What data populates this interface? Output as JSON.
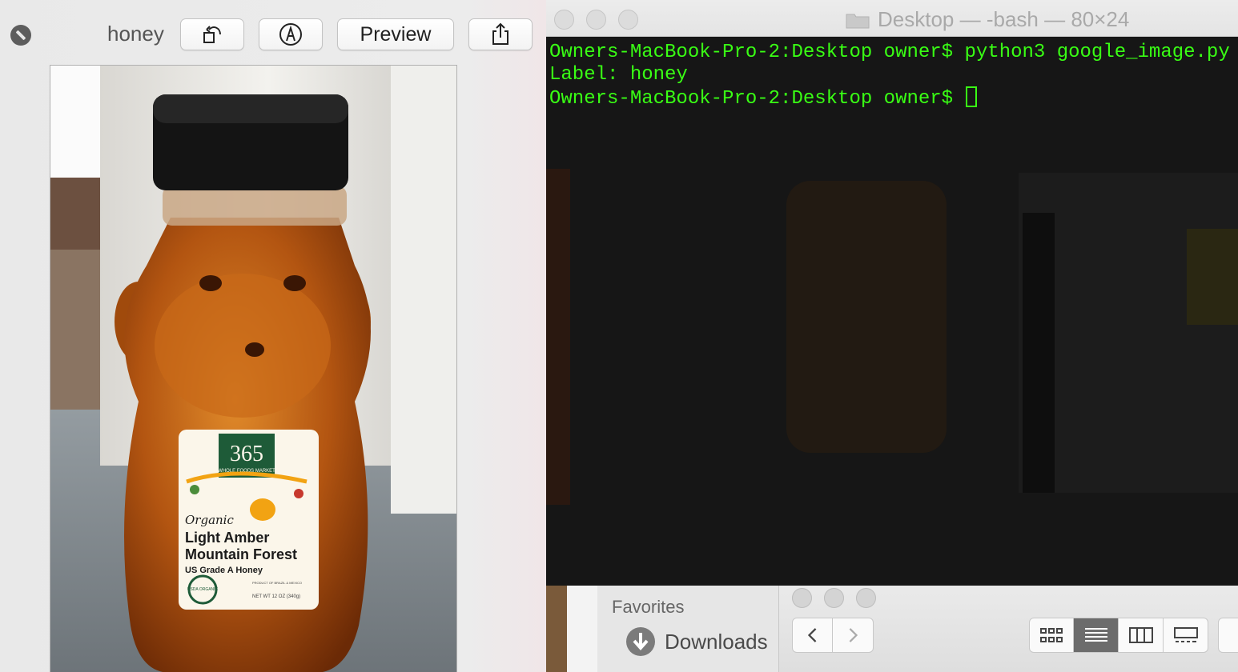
{
  "quicklook": {
    "title": "honey",
    "buttons": {
      "rotate_icon": "rotate-left-icon",
      "markup_icon": "markup-pen-icon",
      "preview_label": "Preview",
      "share_icon": "share-icon"
    },
    "image_label": {
      "brand_number": "365",
      "brand_sub": "WHOLE FOODS MARKET",
      "line1": "Organic",
      "line2": "Light Amber",
      "line3": "Mountain Forest",
      "line4": "US Grade A Honey",
      "usda": "USDA ORGANIC",
      "weight": "NET WT 12 OZ (340g)",
      "origin": "PRODUCT OF BRAZIL & MEXICO"
    }
  },
  "terminal": {
    "title": "Desktop — -bash — 80×24",
    "lines": [
      "Owners-MacBook-Pro-2:Desktop owner$ python3 google_image.py",
      "Label: honey",
      "Owners-MacBook-Pro-2:Desktop owner$ "
    ],
    "text_color": "#39ff14",
    "background": "#151515"
  },
  "finder": {
    "sidebar_heading": "Favorites",
    "sidebar_items": [
      {
        "label": "Downloads",
        "icon": "download-icon"
      }
    ],
    "nav": {
      "back_icon": "chevron-left-icon",
      "forward_icon": "chevron-right-icon"
    },
    "view_modes": [
      "icon-view-icon",
      "list-view-icon",
      "column-view-icon",
      "gallery-view-icon"
    ],
    "active_view": "list-view-icon"
  }
}
